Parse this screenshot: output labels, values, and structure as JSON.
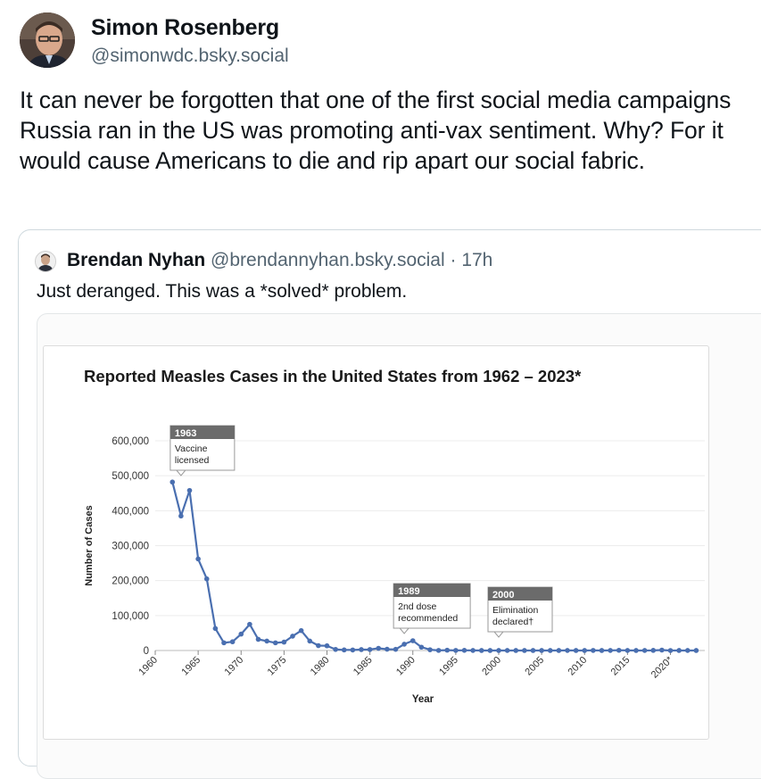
{
  "post": {
    "author_name": "Simon Rosenberg",
    "author_handle": "@simonwdc.bsky.social",
    "text": "It can never be forgotten that one of the first social media campaigns Russia ran in the US was promoting anti-vax sentiment.  Why? For it would cause Americans to die and rip apart our social fabric."
  },
  "quote": {
    "author_name": "Brendan Nyhan",
    "author_handle": "@brendannyhan.bsky.social",
    "separator": "·",
    "time": "17h",
    "text": "Just deranged. This was a *solved* problem."
  },
  "colors": {
    "line": "#4a6fb0",
    "callout_header": "#6b6b6b",
    "grid": "#ececec"
  },
  "chart_data": {
    "type": "line",
    "title": "Reported Measles Cases in the United States from 1962 – 2023*",
    "xlabel": "Year",
    "ylabel": "Number of Cases",
    "ylim": [
      0,
      600000
    ],
    "xlim": [
      1960,
      2024
    ],
    "y_ticks": [
      0,
      100000,
      200000,
      300000,
      400000,
      500000,
      600000
    ],
    "y_tick_labels": [
      "0",
      "100,000",
      "200,000",
      "300,000",
      "400,000",
      "500,000",
      "600,000"
    ],
    "x_ticks": [
      1960,
      1965,
      1970,
      1975,
      1980,
      1985,
      1990,
      1995,
      2000,
      2005,
      2010,
      2015,
      2020
    ],
    "x_tick_labels": [
      "1960",
      "1965",
      "1970",
      "1975",
      "1980",
      "1985",
      "1990",
      "1995",
      "2000",
      "2005",
      "2010",
      "2015",
      "2020*"
    ],
    "grid": true,
    "series": [
      {
        "x": [
          1962,
          1963,
          1964,
          1965,
          1966,
          1967,
          1968,
          1969,
          1970,
          1971,
          1972,
          1973,
          1974,
          1975,
          1976,
          1977,
          1978,
          1979,
          1980,
          1981,
          1982,
          1983,
          1984,
          1985,
          1986,
          1987,
          1988,
          1989,
          1990,
          1991,
          1992,
          1993,
          1994,
          1995,
          1996,
          1997,
          1998,
          1999,
          2000,
          2001,
          2002,
          2003,
          2004,
          2005,
          2006,
          2007,
          2008,
          2009,
          2010,
          2011,
          2012,
          2013,
          2014,
          2015,
          2016,
          2017,
          2018,
          2019,
          2020,
          2021,
          2022,
          2023
        ],
        "values": [
          482000,
          385000,
          458000,
          262000,
          205000,
          63000,
          22000,
          25000,
          47000,
          75000,
          32000,
          27000,
          22000,
          24000,
          41000,
          57000,
          27000,
          14000,
          13500,
          3100,
          1700,
          1500,
          2600,
          2800,
          6300,
          3700,
          3400,
          18000,
          28000,
          9600,
          2200,
          310,
          960,
          310,
          510,
          140,
          100,
          100,
          90,
          120,
          40,
          60,
          40,
          70,
          60,
          40,
          140,
          70,
          60,
          220,
          55,
          190,
          670,
          190,
          90,
          120,
          380,
          1280,
          13,
          50,
          120,
          60
        ]
      }
    ],
    "annotations": [
      {
        "x": 1963,
        "header": "1963",
        "lines": [
          "Vaccine",
          "licensed"
        ]
      },
      {
        "x": 1989,
        "header": "1989",
        "lines": [
          "2nd dose",
          "recommended"
        ]
      },
      {
        "x": 2000,
        "header": "2000",
        "lines": [
          "Elimination",
          "declared†"
        ]
      }
    ]
  }
}
